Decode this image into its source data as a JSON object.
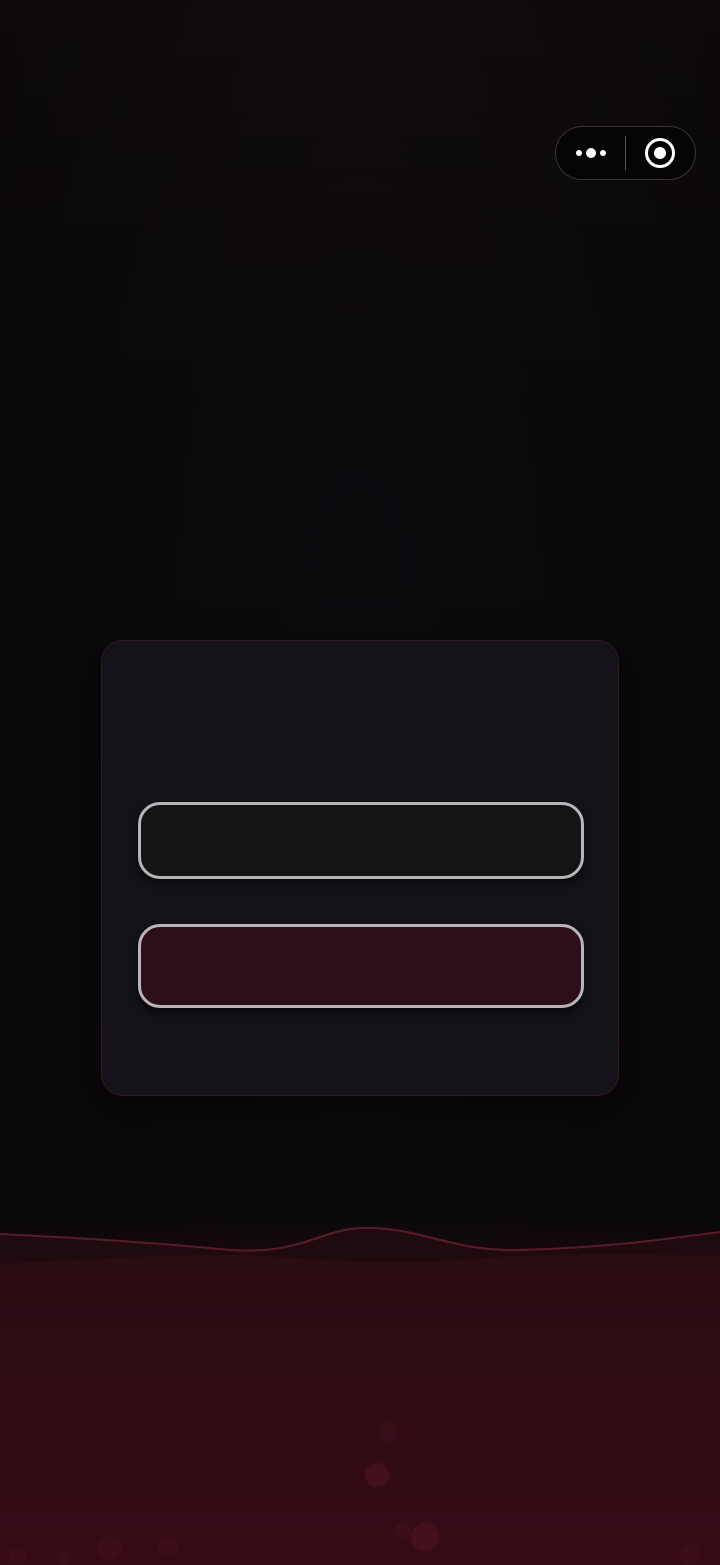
{
  "capsule": {
    "more_icon": "more-dots-icon",
    "close_icon": "target-circle-icon"
  },
  "dialog": {
    "title": "",
    "primary_button": "",
    "secondary_button": ""
  },
  "colors": {
    "background": "#0d0b0e",
    "card": "#131218",
    "card_border": "#3a1720",
    "button_border": "#b9b4b7",
    "button_primary": "#141415",
    "button_secondary": "#2c0f19",
    "wave": "#350b16",
    "wave_line": "#5a1a2a"
  }
}
